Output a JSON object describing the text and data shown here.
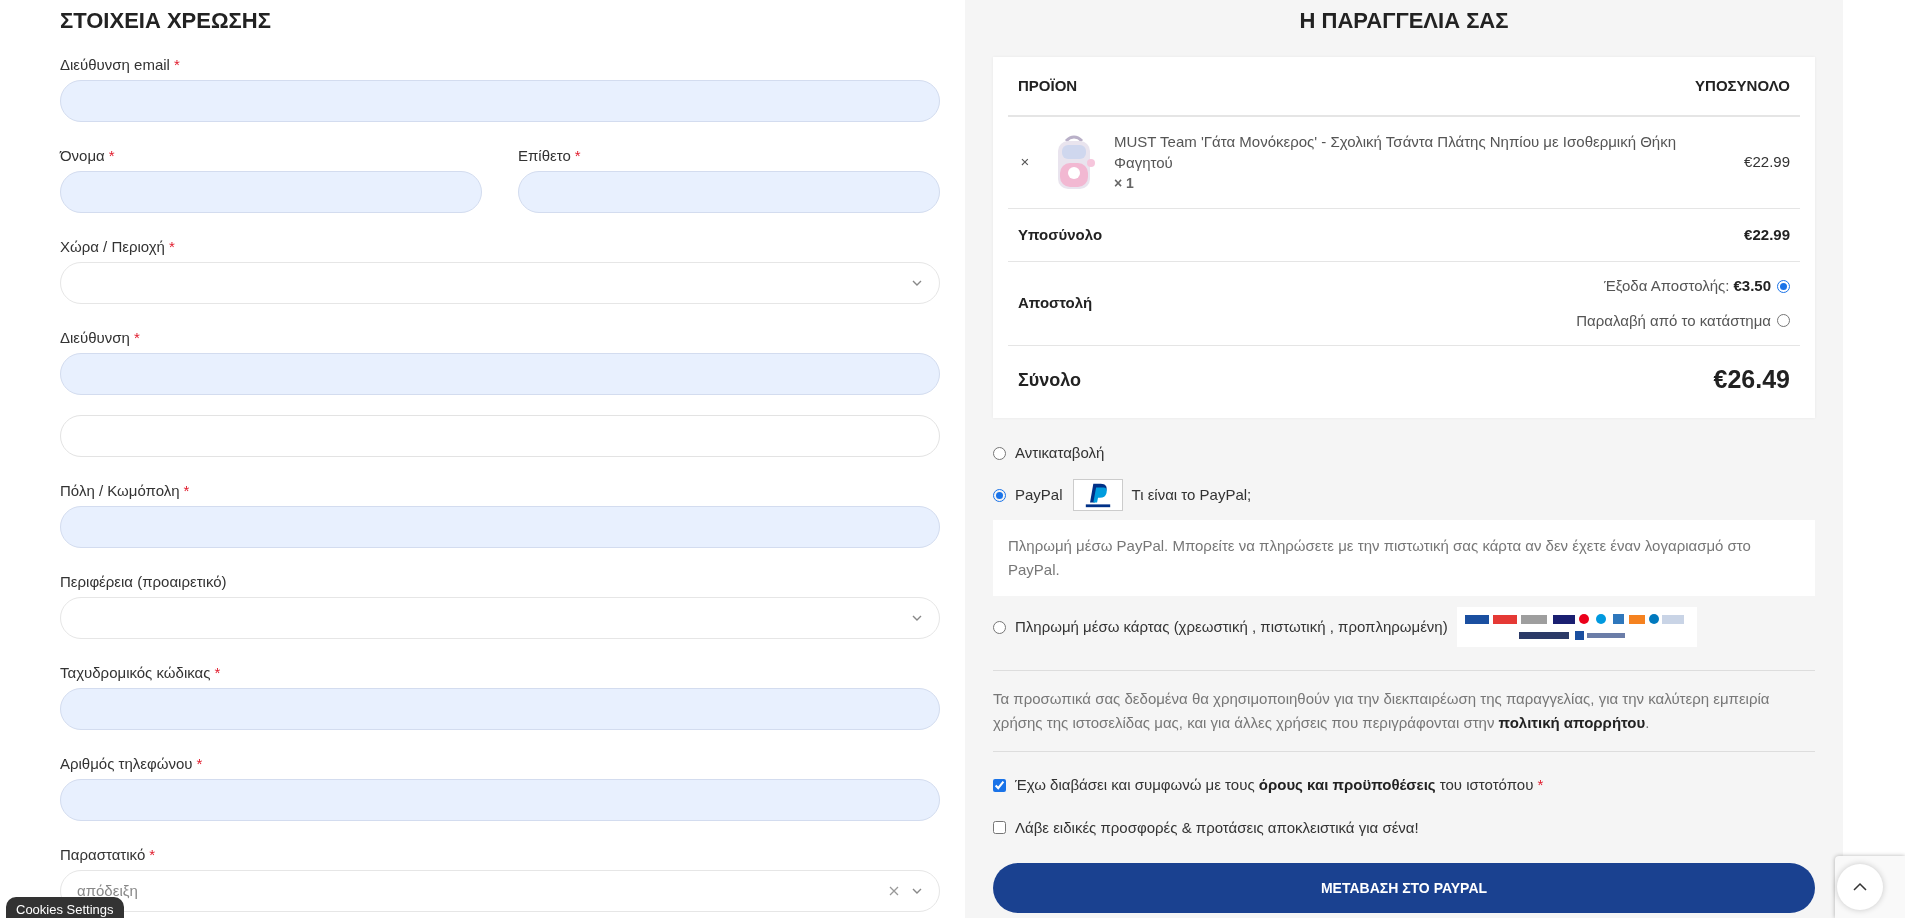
{
  "billing": {
    "title": "ΣΤΟΙΧΕΙΑ ΧΡΕΩΣΗΣ",
    "rows": [
      [
        {
          "label": "Διεύθυνση email",
          "required_mark": "*",
          "kind": "text",
          "autofilled": true
        }
      ],
      [
        {
          "label": "Όνομα",
          "required_mark": "*",
          "kind": "text",
          "autofilled": true
        },
        {
          "label": "Επίθετο",
          "required_mark": "*",
          "kind": "text",
          "autofilled": true
        }
      ],
      [
        {
          "label": "Χώρα / Περιοχή",
          "required_mark": "*",
          "kind": "select"
        }
      ],
      [
        {
          "label": "Διεύθυνση",
          "required_mark": "*",
          "kind": "text",
          "autofilled": true
        }
      ],
      [
        {
          "kind": "text",
          "autofilled": false
        }
      ],
      [
        {
          "label": "Πόλη / Κωμόπολη",
          "required_mark": "*",
          "kind": "text",
          "autofilled": true
        }
      ],
      [
        {
          "label": "Περιφέρεια (προαιρετικό)",
          "kind": "select"
        }
      ],
      [
        {
          "label": "Ταχυδρομικός κώδικας",
          "required_mark": "*",
          "kind": "text",
          "autofilled": true
        }
      ],
      [
        {
          "label": "Αριθμός τηλεφώνου",
          "required_mark": "*",
          "kind": "text",
          "autofilled": true
        }
      ],
      [
        {
          "label": "Παραστατικό",
          "required_mark": "*",
          "kind": "select",
          "value": "απόδειξη",
          "clearable": true
        }
      ]
    ]
  },
  "cookies_button": "Cookies Settings",
  "order": {
    "title": "Η ΠΑΡΑΓΓΕΛΙΑ ΣΑΣ",
    "columns": [
      "ΠΡΟΪΟΝ",
      "ΥΠΟΣΥΝΟΛΟ"
    ],
    "items": [
      {
        "remove": "×",
        "name": "MUST Team 'Γάτα Μονόκερος' - Σχολική Τσάντα Πλάτης Νηπίου με Ισοθερμική Θήκη Φαγητού",
        "quantity": "× 1",
        "price": "€22.99"
      }
    ],
    "subtotal": {
      "label": "Υποσύνολο",
      "value": "€22.99"
    },
    "shipping": {
      "label": "Αποστολή",
      "options": [
        {
          "label": "Έξοδα Αποστολής:",
          "price": "€3.50",
          "selected": true
        },
        {
          "label": "Παραλαβή από το κατάστημα",
          "selected": false
        }
      ]
    },
    "total": {
      "label": "Σύνολο",
      "value": "€26.49"
    }
  },
  "payment": {
    "methods": [
      {
        "kind": "plain",
        "label": "Αντικαταβολή",
        "selected": false
      },
      {
        "kind": "paypal",
        "label": "PayPal",
        "link": "Τι είναι το PayPal;",
        "selected": true,
        "description": "Πληρωμή μέσω PayPal. Μπορείτε να πληρώσετε με την πιστωτική σας κάρτα αν δεν έχετε έναν λογαριασμό στο PayPal."
      },
      {
        "kind": "cards",
        "label": "Πληρωμή μέσω κάρτας (χρεωστική , πιστωτική , προπληρωμένη)",
        "selected": false
      }
    ]
  },
  "privacy": {
    "text": "Τα προσωπικά σας δεδομένα θα χρησιμοποιηθούν για την διεκπαιρέωση της παραγγελίας, για την καλύτερη εμπειρία χρήσης της ιστοσελίδας μας, και για άλλες χρήσεις που περιγράφονται στην",
    "link": "πολιτική απορρήτου",
    "end": "."
  },
  "terms": [
    {
      "text": "Έχω διαβάσει και συμφωνώ με τους",
      "link": "όρους και προϋποθέσεις",
      "after": "του ιστοτόπου",
      "required_mark": "*",
      "checked": true
    },
    {
      "text": "Λάβε ειδικές προσφορές & προτάσεις αποκλειστικά για σένα!",
      "checked": false
    }
  ],
  "submit": "ΜΕΤΑΒΑΣΗ ΣΤΟ PAYPAL"
}
